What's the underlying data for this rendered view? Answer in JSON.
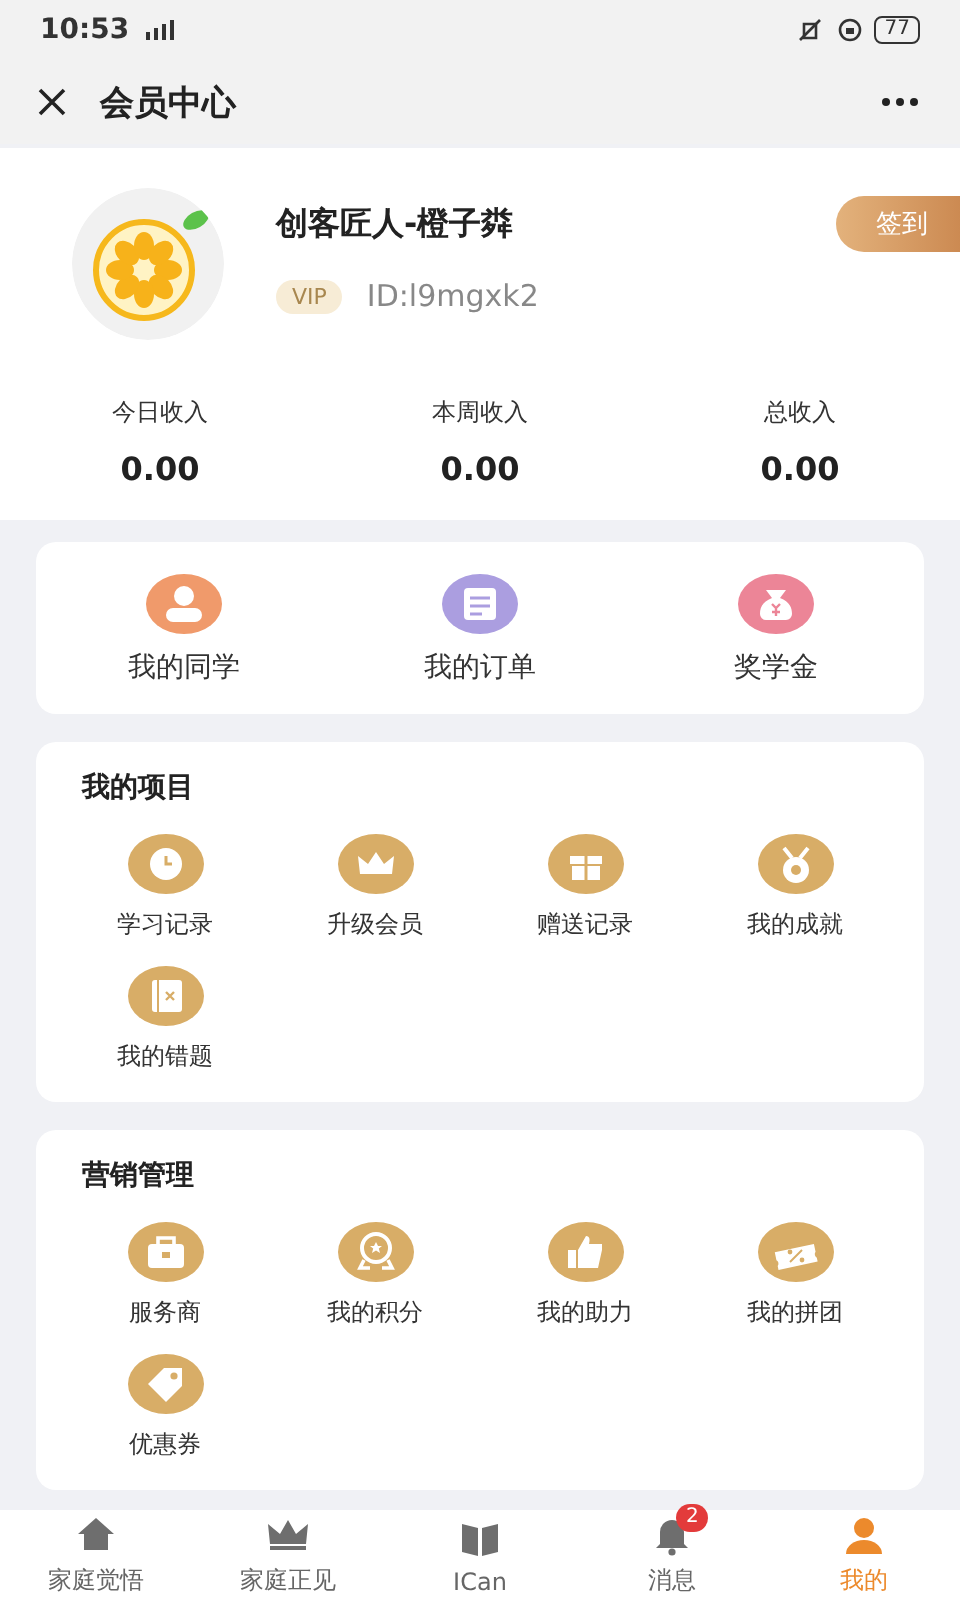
{
  "status_bar": {
    "time": "10:53",
    "battery": "77"
  },
  "header": {
    "title": "会员中心"
  },
  "profile": {
    "name": "创客匠人-橙子粦",
    "badge": "VIP",
    "id": "ID:l9mgxk2",
    "checkin": "签到"
  },
  "stats": [
    {
      "label": "今日收入",
      "value": "0.00"
    },
    {
      "label": "本周收入",
      "value": "0.00"
    },
    {
      "label": "总收入",
      "value": "0.00"
    }
  ],
  "quick_links": [
    {
      "label": "我的同学",
      "kind": "person"
    },
    {
      "label": "我的订单",
      "kind": "list"
    },
    {
      "label": "奖学金",
      "kind": "money"
    }
  ],
  "sections": [
    {
      "title": "我的项目",
      "items": [
        {
          "label": "学习记录",
          "kind": "clock"
        },
        {
          "label": "升级会员",
          "kind": "crown"
        },
        {
          "label": "赠送记录",
          "kind": "gift"
        },
        {
          "label": "我的成就",
          "kind": "medal"
        },
        {
          "label": "我的错题",
          "kind": "notebook"
        }
      ]
    },
    {
      "title": "营销管理",
      "items": [
        {
          "label": "服务商",
          "kind": "briefcase"
        },
        {
          "label": "我的积分",
          "kind": "badge"
        },
        {
          "label": "我的助力",
          "kind": "thumb"
        },
        {
          "label": "我的拼团",
          "kind": "ticket"
        },
        {
          "label": "优惠券",
          "kind": "tag"
        }
      ]
    }
  ],
  "tabbar": [
    {
      "label": "家庭觉悟",
      "kind": "house",
      "selected": false
    },
    {
      "label": "家庭正见",
      "kind": "crown",
      "selected": false
    },
    {
      "label": "ICan",
      "kind": "book",
      "selected": false
    },
    {
      "label": "消息",
      "kind": "bell",
      "selected": false,
      "badge": "2"
    },
    {
      "label": "我的",
      "kind": "person",
      "selected": true
    }
  ]
}
